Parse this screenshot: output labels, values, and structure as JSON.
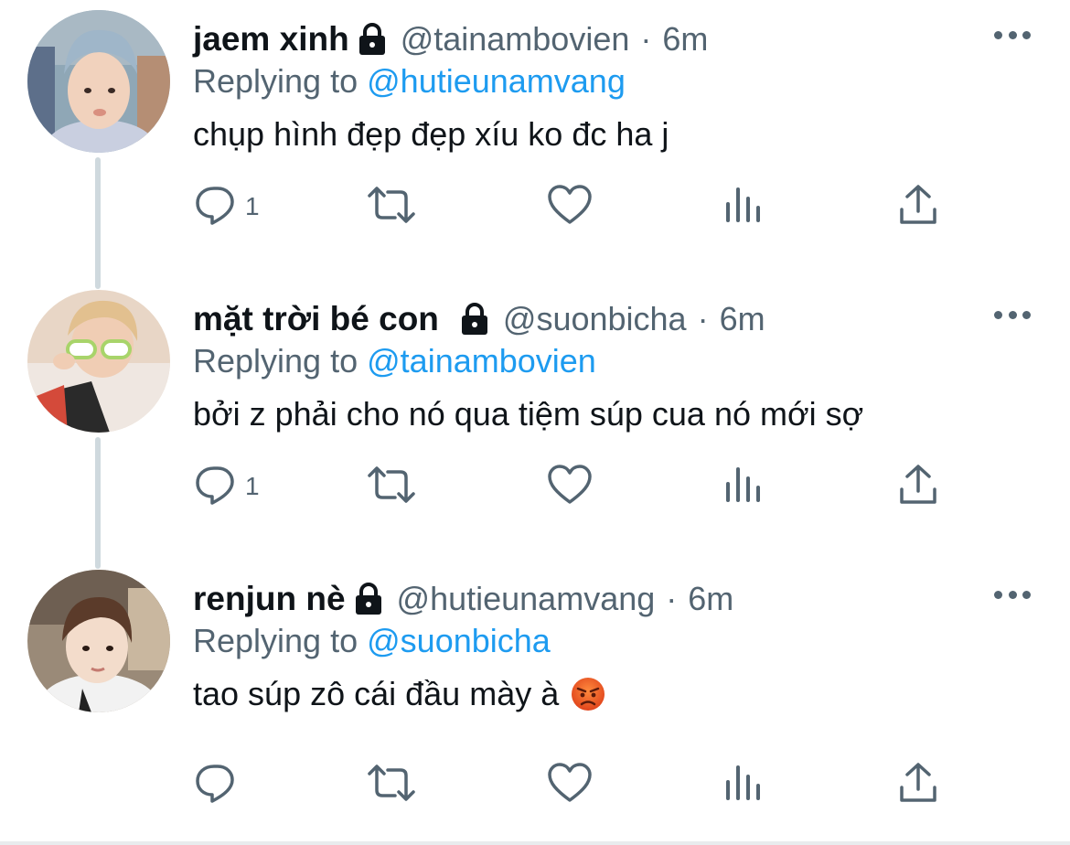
{
  "colors": {
    "text": "#0f1419",
    "secondary": "#536471",
    "link": "#1d9bf0",
    "thread_line": "#cfd9de"
  },
  "tweets": [
    {
      "name": "jaem xinh",
      "handle": "@tainambovien",
      "separator": "·",
      "time": "6m",
      "replying_prefix": "Replying to",
      "replying_to": "@hutieunamvang",
      "text": "chụp hình đẹp đẹp xíu ko đc ha j",
      "reply_count": "1",
      "icons": [
        "lock-icon",
        "more-icon",
        "reply-icon",
        "retweet-icon",
        "like-icon",
        "analytics-icon",
        "share-icon"
      ]
    },
    {
      "name": "mặt trời bé con",
      "handle": "@suonbicha",
      "separator": "·",
      "time": "6m",
      "replying_prefix": "Replying to",
      "replying_to": "@tainambovien",
      "text": "bởi z phải cho nó qua tiệm súp cua nó mới sợ",
      "reply_count": "1",
      "icons": [
        "lock-icon",
        "more-icon",
        "reply-icon",
        "retweet-icon",
        "like-icon",
        "analytics-icon",
        "share-icon"
      ]
    },
    {
      "name": "renjun nè",
      "handle": "@hutieunamvang",
      "separator": "·",
      "time": "6m",
      "replying_prefix": "Replying to",
      "replying_to": "@suonbicha",
      "text": "tao súp zô cái đầu mày à",
      "emoji": "angry-face-emoji",
      "reply_count": "",
      "icons": [
        "lock-icon",
        "more-icon",
        "reply-icon",
        "retweet-icon",
        "like-icon",
        "analytics-icon",
        "share-icon"
      ]
    }
  ]
}
